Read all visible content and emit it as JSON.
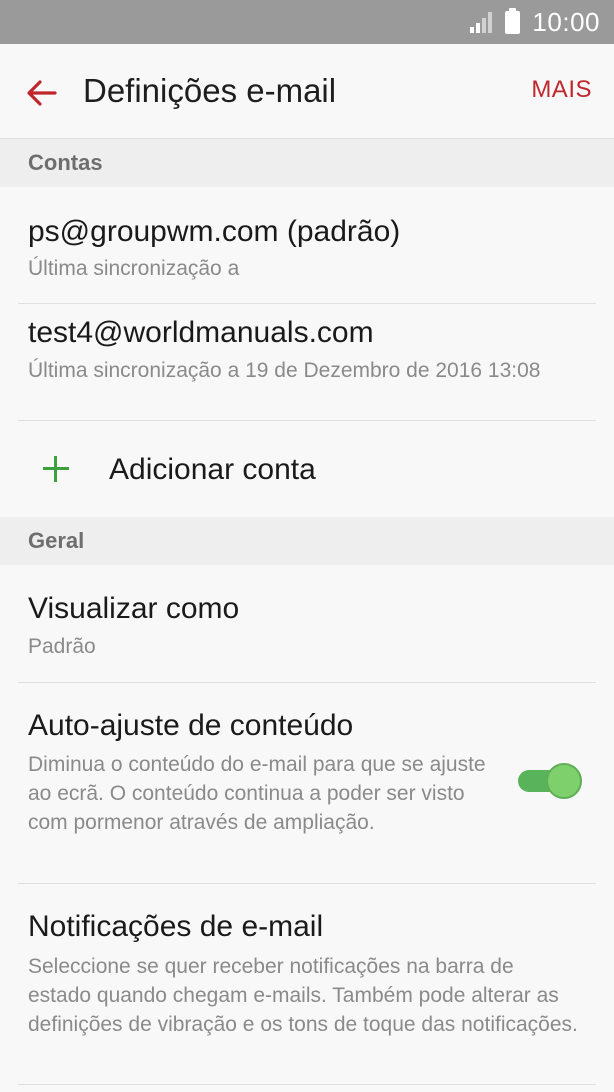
{
  "status_bar": {
    "time": "10:00",
    "signal_icon": "signal-icon",
    "battery_icon": "battery-icon"
  },
  "app_bar": {
    "back_icon": "arrow-left-icon",
    "title": "Definições e-mail",
    "more_label": "MAIS"
  },
  "colors": {
    "accent": "#c0272d",
    "add_green": "#3aa13d",
    "toggle_on": "#7ed06d",
    "status_bar": "#9a9a9a"
  },
  "sections": {
    "accounts": {
      "header": "Contas",
      "items": [
        {
          "title": "ps@groupwm.com (padrão)",
          "subtitle": "Última sincronização a"
        },
        {
          "title": "test4@worldmanuals.com",
          "subtitle": "Última sincronização a 19 de Dezembro de 2016 13:08"
        }
      ],
      "add_label": "Adicionar conta",
      "add_icon": "plus-icon"
    },
    "general": {
      "header": "Geral",
      "items": [
        {
          "title": "Visualizar como",
          "subtitle": "Padrão"
        },
        {
          "title": "Auto-ajuste de conteúdo",
          "subtitle": "Diminua o conteúdo do e-mail para que se ajuste ao ecrã. O conteúdo continua a poder ser visto com pormenor através de ampliação.",
          "toggle_on": true
        },
        {
          "title": "Notificações de e-mail",
          "subtitle": "Seleccione se quer receber notificações na barra de estado quando chegam e-mails. Também pode alterar as definições de vibração e os tons de toque das notificações."
        }
      ]
    }
  }
}
